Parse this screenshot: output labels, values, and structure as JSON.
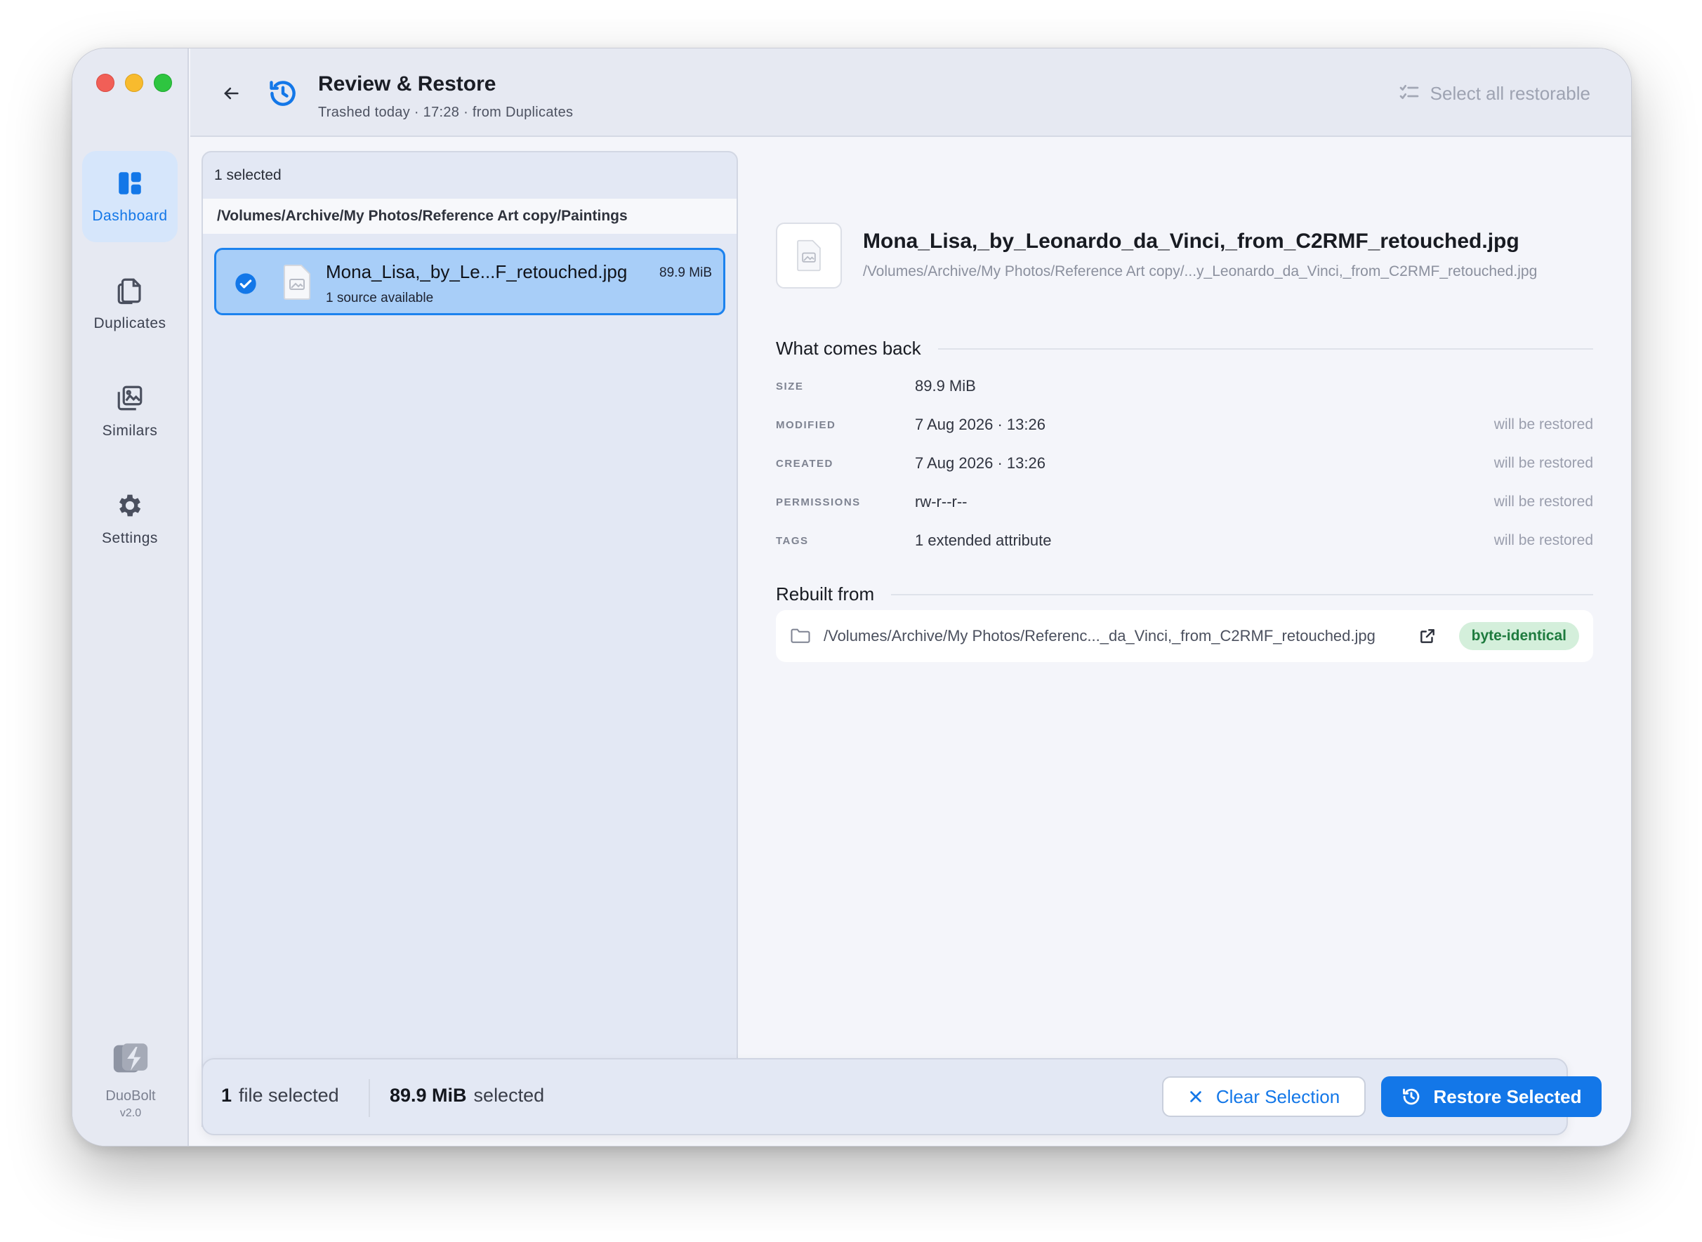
{
  "sidebar": {
    "items": [
      {
        "label": "Dashboard",
        "icon": "dashboard-icon",
        "active": true
      },
      {
        "label": "Duplicates",
        "icon": "duplicates-icon",
        "active": false
      },
      {
        "label": "Similars",
        "icon": "similars-icon",
        "active": false
      },
      {
        "label": "Settings",
        "icon": "gear-icon",
        "active": false
      }
    ],
    "brand": {
      "name": "DuoBolt",
      "version": "v2.0"
    }
  },
  "header": {
    "title": "Review & Restore",
    "subtitle": "Trashed today · 17:28 · from Duplicates",
    "select_all": "Select all restorable"
  },
  "list": {
    "selected_count": "1 selected",
    "group_path": "/Volumes/Archive/My Photos/Reference Art copy/Paintings",
    "rows": [
      {
        "name": "Mona_Lisa,_by_Le...F_retouched.jpg",
        "sources": "1 source available",
        "size": "89.9 MiB",
        "checked": true
      }
    ]
  },
  "detail": {
    "file_name": "Mona_Lisa,_by_Leonardo_da_Vinci,_from_C2RMF_retouched.jpg",
    "file_path": "/Volumes/Archive/My Photos/Reference Art copy/...y_Leonardo_da_Vinci,_from_C2RMF_retouched.jpg",
    "what_comes_back": {
      "title": "What comes back",
      "rows": [
        {
          "key": "SIZE",
          "value": "89.9 MiB",
          "note": ""
        },
        {
          "key": "MODIFIED",
          "value": "7 Aug 2026 · 13:26",
          "note": "will be restored"
        },
        {
          "key": "CREATED",
          "value": "7 Aug 2026 · 13:26",
          "note": "will be restored"
        },
        {
          "key": "PERMISSIONS",
          "value": "rw-r--r--",
          "note": "will be restored"
        },
        {
          "key": "TAGS",
          "value": "1 extended attribute",
          "note": "will be restored"
        }
      ]
    },
    "rebuilt_from": {
      "title": "Rebuilt from",
      "path": "/Volumes/Archive/My Photos/Referenc..._da_Vinci,_from_C2RMF_retouched.jpg",
      "badge": "byte-identical"
    }
  },
  "footer": {
    "file_count_num": "1",
    "file_count_label": "file selected",
    "size_num": "89.9 MiB",
    "size_label": "selected",
    "clear_label": "Clear Selection",
    "restore_label": "Restore Selected"
  },
  "colors": {
    "accent": "#1377e8",
    "selected_row": "#a8cef8",
    "badge_bg": "#d4efdb",
    "badge_text": "#1e7b3e"
  }
}
